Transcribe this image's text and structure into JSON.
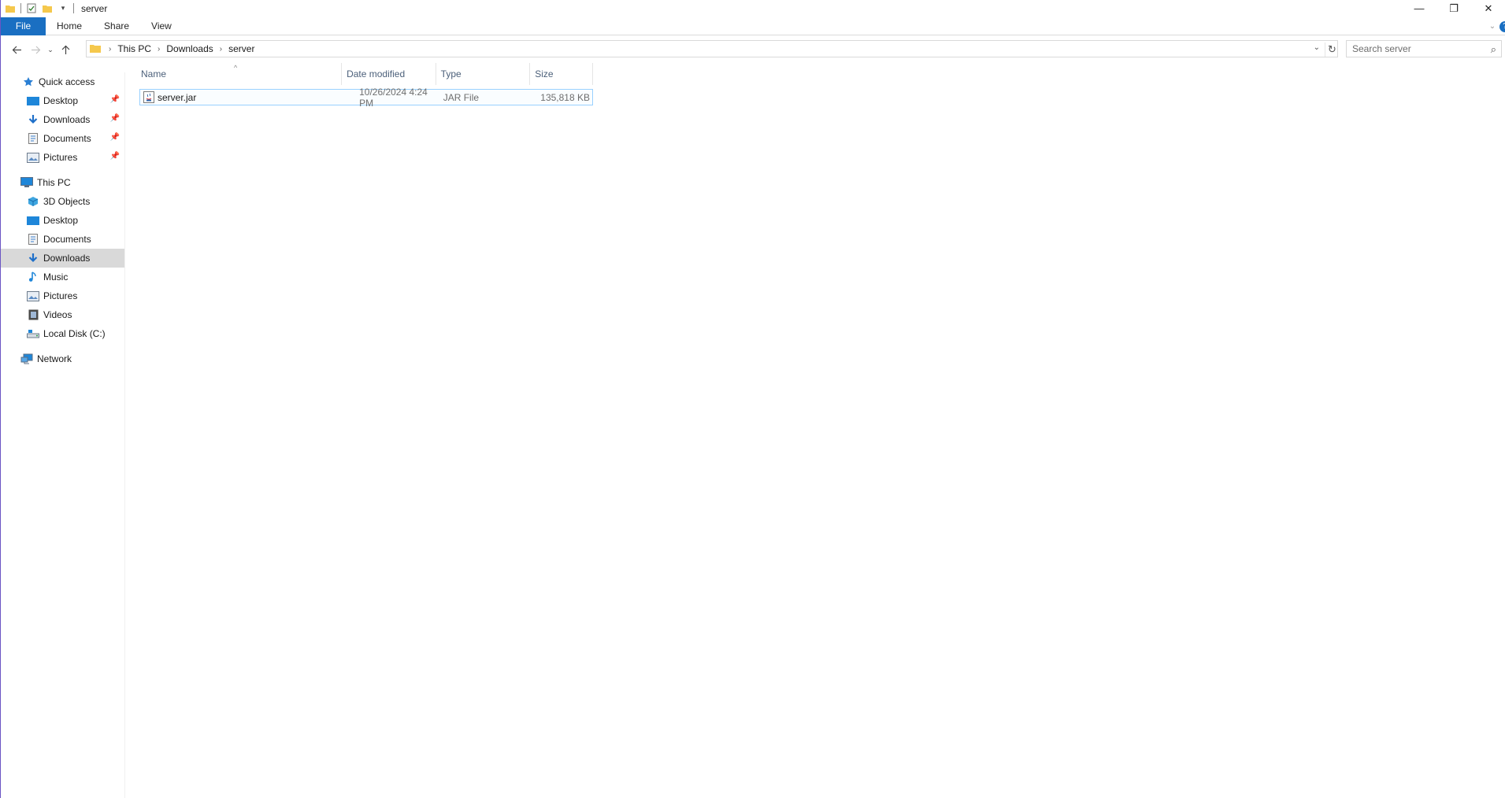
{
  "window": {
    "title": "server",
    "controls": {
      "minimize": "—",
      "restore": "❐",
      "close": "✕"
    }
  },
  "ribbon": {
    "tabs": [
      "File",
      "Home",
      "Share",
      "View"
    ]
  },
  "address": {
    "crumbs": [
      "This PC",
      "Downloads",
      "server"
    ]
  },
  "search": {
    "placeholder": "Search server"
  },
  "sidebar": {
    "quick_access": {
      "label": "Quick access",
      "items": [
        {
          "label": "Desktop",
          "icon": "desktop-icon",
          "pinned": true
        },
        {
          "label": "Downloads",
          "icon": "downloads-icon",
          "pinned": true
        },
        {
          "label": "Documents",
          "icon": "documents-icon",
          "pinned": true
        },
        {
          "label": "Pictures",
          "icon": "pictures-icon",
          "pinned": true
        }
      ]
    },
    "this_pc": {
      "label": "This PC",
      "items": [
        {
          "label": "3D Objects",
          "icon": "3d-objects-icon"
        },
        {
          "label": "Desktop",
          "icon": "desktop-icon"
        },
        {
          "label": "Documents",
          "icon": "documents-icon"
        },
        {
          "label": "Downloads",
          "icon": "downloads-icon",
          "selected": true
        },
        {
          "label": "Music",
          "icon": "music-icon"
        },
        {
          "label": "Pictures",
          "icon": "pictures-icon"
        },
        {
          "label": "Videos",
          "icon": "videos-icon"
        },
        {
          "label": "Local Disk (C:)",
          "icon": "local-disk-icon"
        }
      ]
    },
    "network": {
      "label": "Network",
      "icon": "network-icon"
    }
  },
  "columns": [
    "Name",
    "Date modified",
    "Type",
    "Size"
  ],
  "files": [
    {
      "name": "server.jar",
      "date_modified": "10/26/2024 4:24 PM",
      "type": "JAR File",
      "size": "135,818 KB",
      "icon": "jar-file-icon"
    }
  ],
  "colors": {
    "file_tab": "#1a6fc2",
    "selection_border": "#99d1ff",
    "sidebar_selected": "#d9d9d9",
    "column_header_text": "#4c607a"
  }
}
